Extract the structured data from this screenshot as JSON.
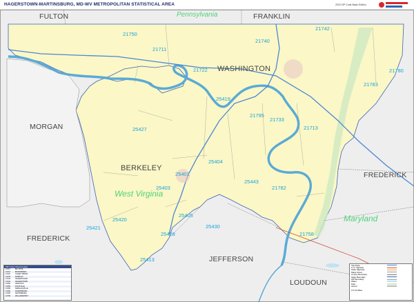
{
  "title": "HAGERSTOWN-MARTINSBURG, MD-WV METROPOLITAN STATISTICAL AREA",
  "edition": "2023 ZIP Code Basic Edition",
  "logo": {
    "name": "Market Maps",
    "colors": [
      "#d9262b",
      "#2f64b5"
    ]
  },
  "colors": {
    "water": "#bfe3f4",
    "river": "#5aaad6",
    "msa_fill": "#fbf7c6",
    "outside_fill": "#eeeeee",
    "zip_label": "#1aa3d9",
    "state_label": "#4fd17b",
    "boundary": "#3a63b5",
    "interstate": "#4b86d6"
  },
  "counties": {
    "fulton": "FULTON",
    "franklin": "FRANKLIN",
    "washington": "WASHINGTON",
    "morgan": "MORGAN",
    "berkeley": "BERKELEY",
    "frederick_md": "FREDERICK",
    "frederick_va": "FREDERICK",
    "jefferson": "JEFFERSON",
    "loudoun": "LOUDOUN"
  },
  "states": {
    "pennsylvania": "Pennsylvania",
    "west_virginia": "West Virginia",
    "maryland": "Maryland"
  },
  "zips": {
    "z21750": "21750",
    "z21742": "21742",
    "z21711": "21711",
    "z21740": "21740",
    "z21722": "21722",
    "z21780": "21780",
    "z21783": "21783",
    "z25419": "25419",
    "z21795": "21795",
    "z21733": "21733",
    "z21713": "21713",
    "z25427": "25427",
    "z25404": "25404",
    "z25401": "25401",
    "z25403": "25403",
    "z25443": "25443",
    "z21782": "21782",
    "z25405": "25405",
    "z25420": "25420",
    "z25421": "25421",
    "z25430": "25430",
    "z25428": "25428",
    "z21758": "21758",
    "z25413": "25413"
  },
  "inset": {
    "heading": "ZIP Code Cities/Locales",
    "rows": [
      [
        "21711",
        "BIG POOL"
      ],
      [
        "21713",
        "BOONSBORO"
      ],
      [
        "21722",
        "CLEAR SPRING"
      ],
      [
        "21733",
        "FAIRPLAY"
      ],
      [
        "21740",
        "HAGERSTOWN"
      ],
      [
        "21742",
        "HAGERSTOWN"
      ],
      [
        "21750",
        "HANCOCK"
      ],
      [
        "21758",
        "KNOXVILLE"
      ],
      [
        "21780",
        "SABILLASVILLE"
      ],
      [
        "21782",
        "SHARPSBURG"
      ],
      [
        "21783",
        "SMITHSBURG"
      ],
      [
        "21795",
        "WILLIAMSPORT"
      ]
    ]
  },
  "legend": {
    "items": [
      "Interstate",
      "U.S. Highway",
      "State Highway",
      "Major Road",
      "County Boundary",
      "State Boundary",
      "ZIP Boundary",
      "Water",
      "Park",
      "Airport"
    ],
    "scale": "0 5 10 Miles"
  }
}
